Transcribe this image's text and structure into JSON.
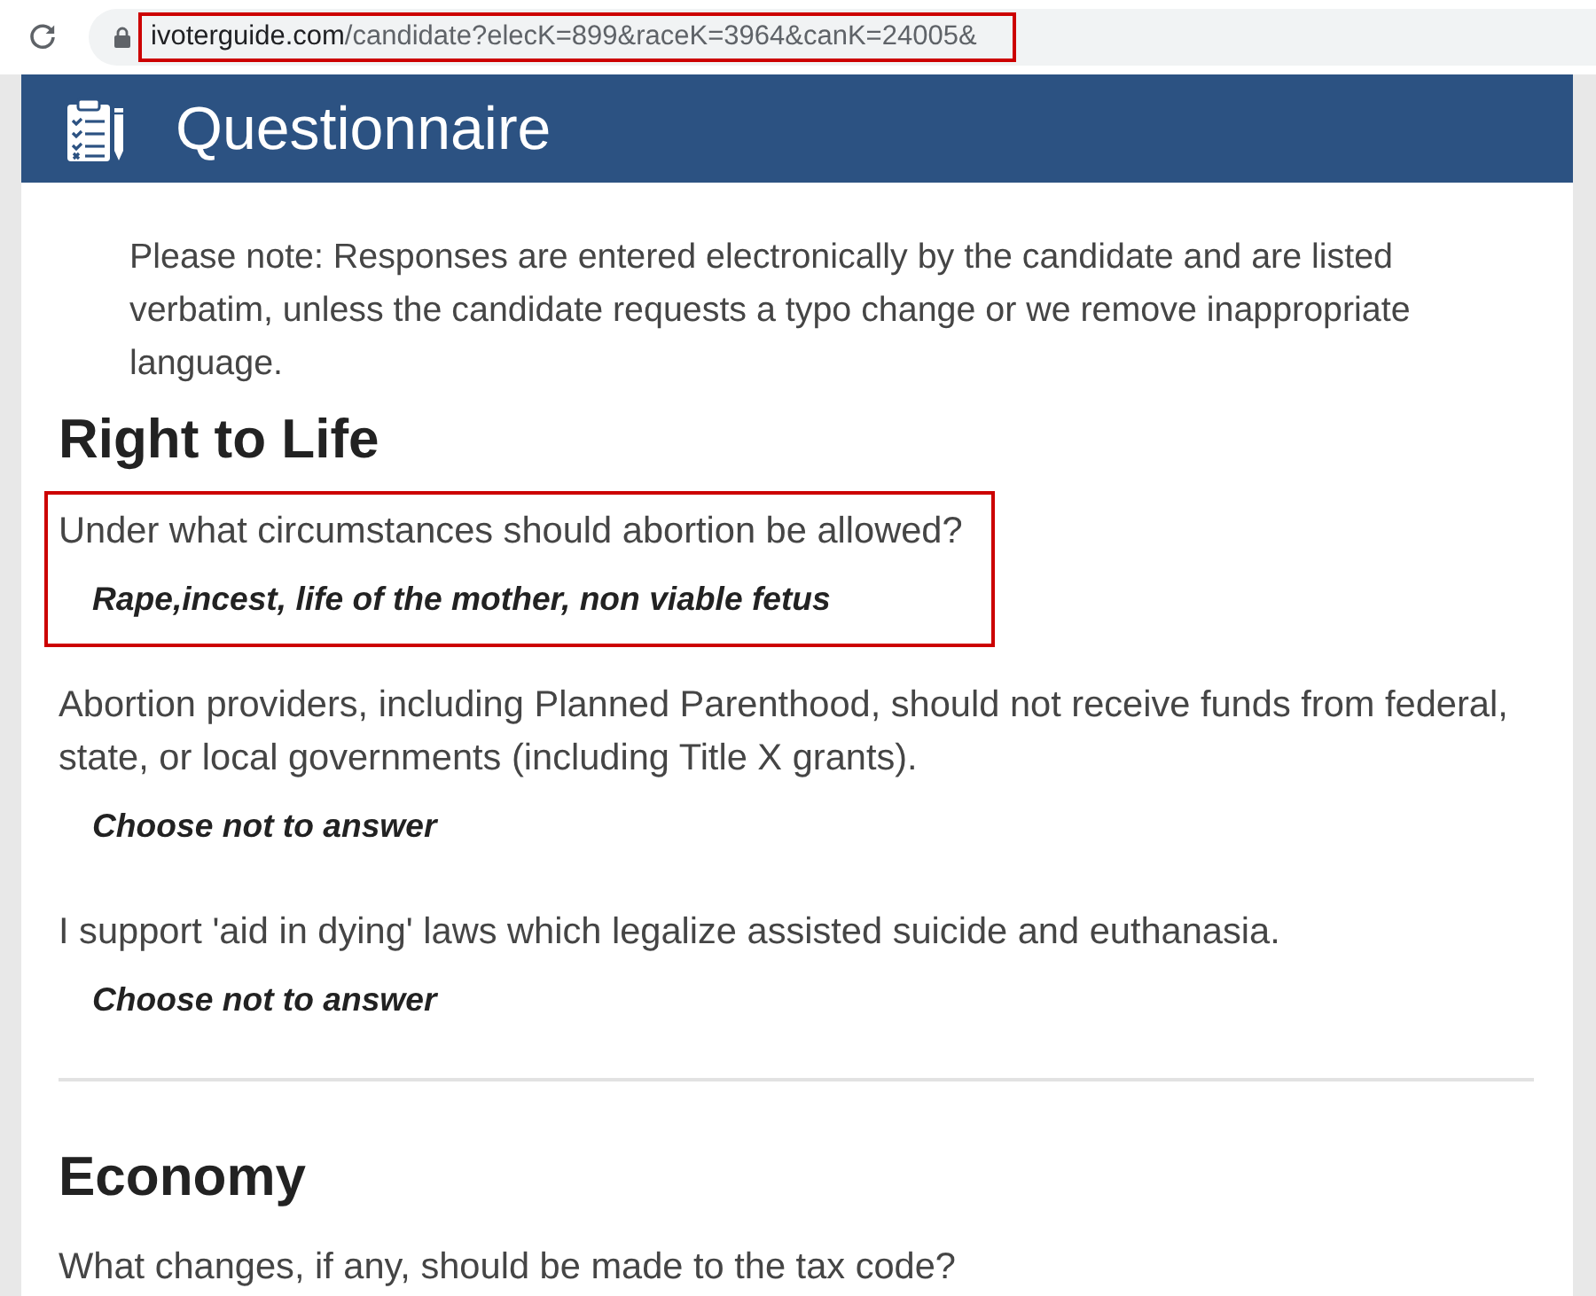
{
  "browser": {
    "url": {
      "domain": "ivoterguide.com",
      "path": "/candidate?elecK=899&raceK=3964&canK=24005&",
      "highlighted": true
    }
  },
  "header": {
    "title": "Questionnaire"
  },
  "note": "Please note: Responses are entered electronically by the candidate and are listed verbatim, unless the candidate requests a typo change or we remove inappropriate language.",
  "sections": [
    {
      "title": "Right to Life",
      "questions": [
        {
          "question": "Under what circumstances should abortion be allowed?",
          "answer": "Rape,incest, life of the mother, non viable fetus",
          "highlighted": true
        },
        {
          "question": "Abortion providers, including Planned Parenthood, should not receive funds from federal, state, or local governments (including Title X grants).",
          "answer": "Choose not to answer",
          "highlighted": false
        },
        {
          "question": "I support 'aid in dying' laws which legalize assisted suicide and euthanasia.",
          "answer": "Choose not to answer",
          "highlighted": false
        }
      ]
    },
    {
      "title": "Economy",
      "questions": [
        {
          "question": "What changes, if any, should be made to the tax code?",
          "highlighted": false
        }
      ]
    }
  ]
}
